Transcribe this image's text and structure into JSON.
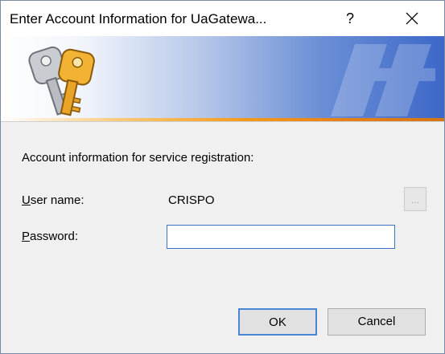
{
  "window": {
    "title": "Enter Account Information for UaGatewa...",
    "help_label": "?",
    "close_label": "X"
  },
  "banner": {
    "icon": "keys-icon",
    "accent_color": "#f39a1e",
    "gradient_color": "#3d68c8"
  },
  "form": {
    "heading": "Account information for service registration:",
    "username_label_first": "U",
    "username_label_rest": "ser name:",
    "username_value": "CRISPO",
    "browse_label": "...",
    "password_label_first": "P",
    "password_label_rest": "assword:",
    "password_value": ""
  },
  "buttons": {
    "ok_label": "OK",
    "cancel_label": "Cancel"
  }
}
